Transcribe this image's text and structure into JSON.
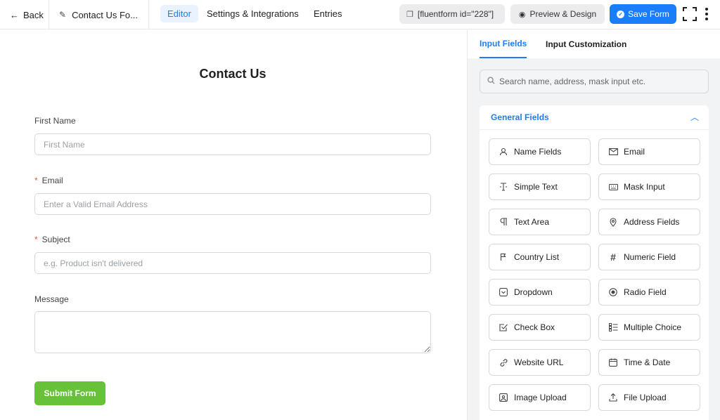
{
  "topbar": {
    "back_label": "Back",
    "form_title": "Contact Us Fo...",
    "tabs": [
      {
        "label": "Editor",
        "active": true
      },
      {
        "label": "Settings & Integrations",
        "active": false
      },
      {
        "label": "Entries",
        "active": false
      }
    ],
    "shortcode": "[fluentform id=\"228\"]",
    "preview_label": "Preview & Design",
    "save_label": "Save Form"
  },
  "form": {
    "heading": "Contact Us",
    "fields": [
      {
        "label": "First Name",
        "required": false,
        "placeholder": "First Name"
      },
      {
        "label": "Email",
        "required": true,
        "placeholder": "Enter a Valid Email Address"
      },
      {
        "label": "Subject",
        "required": true,
        "placeholder": "e.g. Product isn't delivered"
      },
      {
        "label": "Message",
        "required": false
      }
    ],
    "required_mark": "*",
    "submit_label": "Submit Form"
  },
  "panel": {
    "tabs": [
      {
        "label": "Input Fields",
        "active": true
      },
      {
        "label": "Input Customization",
        "active": false
      }
    ],
    "search_placeholder": "Search name, address, mask input etc.",
    "group_title": "General Fields",
    "fields": [
      {
        "label": "Name Fields",
        "icon": "user-icon"
      },
      {
        "label": "Email",
        "icon": "envelope-icon"
      },
      {
        "label": "Simple Text",
        "icon": "text-cursor-icon"
      },
      {
        "label": "Mask Input",
        "icon": "keyboard-icon"
      },
      {
        "label": "Text Area",
        "icon": "paragraph-icon"
      },
      {
        "label": "Address Fields",
        "icon": "map-pin-icon"
      },
      {
        "label": "Country List",
        "icon": "flag-icon"
      },
      {
        "label": "Numeric Field",
        "icon": "hash-icon"
      },
      {
        "label": "Dropdown",
        "icon": "dropdown-icon"
      },
      {
        "label": "Radio Field",
        "icon": "radio-icon"
      },
      {
        "label": "Check Box",
        "icon": "checkbox-icon"
      },
      {
        "label": "Multiple Choice",
        "icon": "list-icon"
      },
      {
        "label": "Website URL",
        "icon": "link-icon"
      },
      {
        "label": "Time & Date",
        "icon": "calendar-icon"
      },
      {
        "label": "Image Upload",
        "icon": "image-icon"
      },
      {
        "label": "File Upload",
        "icon": "upload-icon"
      }
    ]
  },
  "colors": {
    "accent": "#1a7efb",
    "submit": "#67c23a",
    "required": "#e8562a"
  }
}
